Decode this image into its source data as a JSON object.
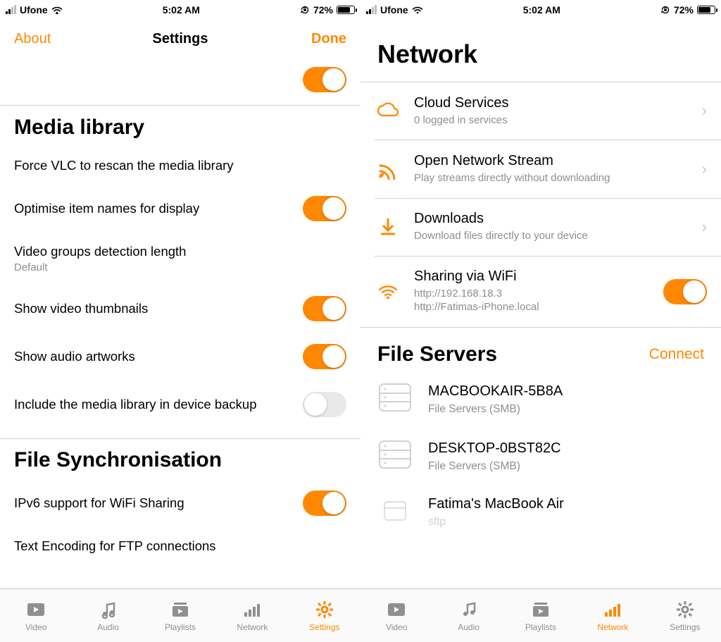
{
  "status": {
    "carrier": "Ufone",
    "time": "5:02 AM",
    "battery": "72%"
  },
  "left_pane": {
    "nav": {
      "left": "About",
      "title": "Settings",
      "right": "Done"
    },
    "sections": {
      "media_library": {
        "header": "Media library",
        "force_rescan": "Force VLC to rescan the media library",
        "optimise": "Optimise item names for display",
        "groups_label": "Video groups detection length",
        "groups_sub": "Default",
        "thumbnails": "Show video thumbnails",
        "artworks": "Show audio artworks",
        "backup": "Include the media library in device backup"
      },
      "file_sync": {
        "header": "File Synchronisation",
        "ipv6": "IPv6 support for WiFi Sharing",
        "ftp_encoding": "Text Encoding for FTP connections"
      }
    },
    "tabs": {
      "video": "Video",
      "audio": "Audio",
      "playlists": "Playlists",
      "network": "Network",
      "settings": "Settings"
    }
  },
  "right_pane": {
    "header": "Network",
    "cloud": {
      "title": "Cloud Services",
      "sub": "0 logged in services"
    },
    "stream": {
      "title": "Open Network Stream",
      "sub": "Play streams directly without downloading"
    },
    "downloads": {
      "title": "Downloads",
      "sub": "Download files directly to your device"
    },
    "wifi": {
      "title": "Sharing via WiFi",
      "line1": "http://192.168.18.3",
      "line2": "http://Fatimas-iPhone.local"
    },
    "file_servers": {
      "header": "File Servers",
      "connect": "Connect"
    },
    "servers": [
      {
        "name": "MACBOOKAIR-5B8A",
        "proto": "File Servers (SMB)"
      },
      {
        "name": "DESKTOP-0BST82C",
        "proto": "File Servers (SMB)"
      },
      {
        "name": "Fatima's MacBook Air",
        "proto": "sftp"
      }
    ],
    "tabs": {
      "video": "Video",
      "audio": "Audio",
      "playlists": "Playlists",
      "network": "Network",
      "settings": "Settings"
    }
  }
}
